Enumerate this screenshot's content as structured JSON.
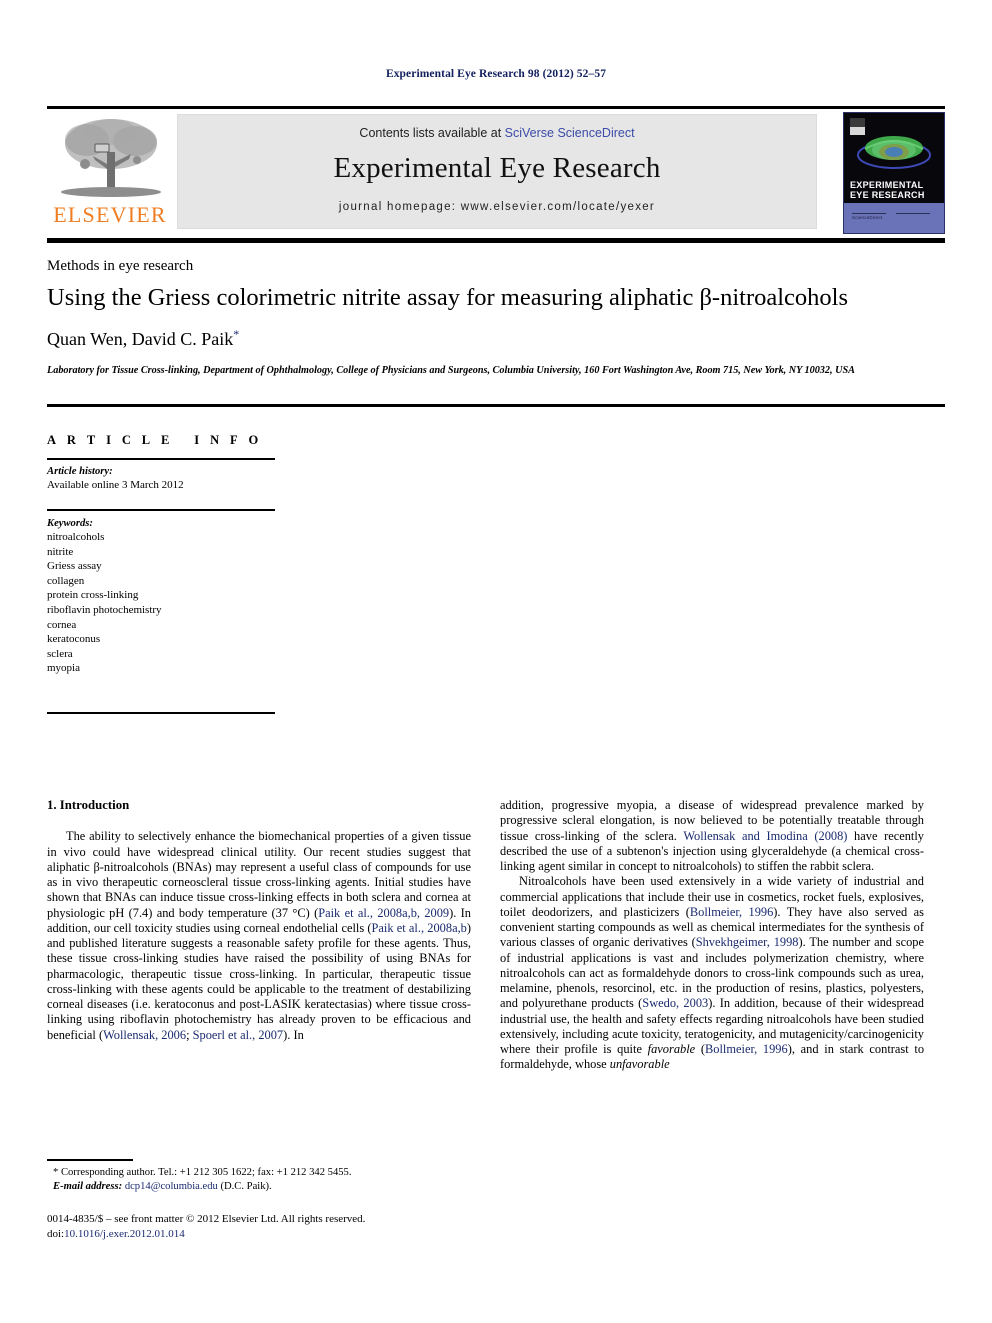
{
  "running_head": "Experimental Eye Research 98 (2012) 52–57",
  "masthead": {
    "contents_prefix": "Contents lists available at ",
    "sciencedirect_link": "SciVerse ScienceDirect",
    "journal_title": "Experimental Eye Research",
    "homepage": "journal homepage: www.elsevier.com/locate/yexer",
    "publisher_logo_text": "ELSEVIER",
    "cover": {
      "title_line1": "EXPERIMENTAL",
      "title_line2": "EYE RESEARCH",
      "band_left_text": "",
      "band_right_text": "ScienceDirect"
    }
  },
  "article": {
    "kicker": "Methods in eye research",
    "title": "Using the Griess colorimetric nitrite assay for measuring aliphatic β-nitroalcohols",
    "authors": "Quan Wen, David C. Paik",
    "corresponding_marker": "*",
    "affiliation": "Laboratory for Tissue Cross-linking, Department of Ophthalmology, College of Physicians and Surgeons, Columbia University, 160 Fort Washington Ave, Room 715, New York, NY 10032, USA"
  },
  "article_info": {
    "heading": "ARTICLE INFO",
    "history_label": "Article history:",
    "history_value": "Available online 3 March 2012",
    "keywords_label": "Keywords:",
    "keywords": [
      "nitroalcohols",
      "nitrite",
      "Griess assay",
      "collagen",
      "protein cross-linking",
      "riboflavin photochemistry",
      "cornea",
      "keratoconus",
      "sclera",
      "myopia"
    ]
  },
  "body": {
    "section_number_title": "1. Introduction",
    "left_paragraph_1_a": "The ability to selectively enhance the biomechanical properties of a given tissue in vivo could have widespread clinical utility. Our recent studies suggest that aliphatic β-nitroalcohols (BNAs) may represent a useful class of compounds for use as in vivo therapeutic corneoscleral tissue cross-linking agents. Initial studies have shown that BNAs can induce tissue cross-linking effects in both sclera and cornea at physiologic pH (7.4) and body temperature (37 °C) (",
    "left_ref_1": "Paik et al., 2008a,b, 2009",
    "left_paragraph_1_b": "). In addition, our cell toxicity studies using corneal endothelial cells (",
    "left_ref_2": "Paik et al., 2008a,b",
    "left_paragraph_1_c": ") and published literature suggests a reasonable safety profile for these agents. Thus, these tissue cross-linking studies have raised the possibility of using BNAs for pharmacologic, therapeutic tissue cross-linking. In particular, therapeutic tissue cross-linking with these agents could be applicable to the treatment of destabilizing corneal diseases (i.e. keratoconus and post-LASIK keratectasias) where tissue cross-linking using riboflavin photochemistry has already proven to be efficacious and beneficial (",
    "left_ref_3": "Wollensak, 2006",
    "left_paragraph_1_d": "; ",
    "left_ref_4": "Spoerl et al., 2007",
    "left_paragraph_1_e": "). In",
    "right_paragraph_1_a": "addition, progressive myopia, a disease of widespread prevalence marked by progressive scleral elongation, is now believed to be potentially treatable through tissue cross-linking of the sclera. ",
    "right_ref_1": "Wollensak and Imodina (2008)",
    "right_paragraph_1_b": " have recently described the use of a subtenon's injection using glyceraldehyde (a chemical cross-linking agent similar in concept to nitroalcohols) to stiffen the rabbit sclera.",
    "right_paragraph_2_a": "Nitroalcohols have been used extensively in a wide variety of industrial and commercial applications that include their use in cosmetics, rocket fuels, explosives, toilet deodorizers, and plasticizers (",
    "right_ref_2": "Bollmeier, 1996",
    "right_paragraph_2_b": "). They have also served as convenient starting compounds as well as chemical intermediates for the synthesis of various classes of organic derivatives (",
    "right_ref_3": "Shvekhgeimer, 1998",
    "right_paragraph_2_c": "). The number and scope of industrial applications is vast and includes polymerization chemistry, where nitroalcohols can act as formaldehyde donors to cross-link compounds such as urea, melamine, phenols, resorcinol, etc. in the production of resins, plastics, polyesters, and polyurethane products (",
    "right_ref_4": "Swedo, 2003",
    "right_paragraph_2_d": "). In addition, because of their widespread industrial use, the health and safety effects regarding nitroalcohols have been studied extensively, including acute toxicity, teratogenicity, and mutagenicity/carcinogenicity where their profile is quite ",
    "right_italic_1": "favorable",
    "right_paragraph_2_e": " (",
    "right_ref_5": "Bollmeier, 1996",
    "right_paragraph_2_f": "), and in stark contrast to formaldehyde, whose ",
    "right_italic_2": "unfavorable"
  },
  "footnotes": {
    "corresponding_line": "* Corresponding author. Tel.: +1 212 305 1622; fax: +1 212 342 5455.",
    "email_label": "E-mail address:",
    "email": "dcp14@columbia.edu",
    "email_owner": "(D.C. Paik).",
    "copyright": "0014-4835/$ – see front matter © 2012 Elsevier Ltd. All rights reserved.",
    "doi_label": "doi:",
    "doi_value": "10.1016/j.exer.2012.01.014"
  },
  "colors": {
    "link_blue": "#3b4ba8",
    "citation_navy": "#1a2a6e",
    "elsevier_orange": "#ef7d21",
    "masthead_grey": "#e6e6e6"
  }
}
